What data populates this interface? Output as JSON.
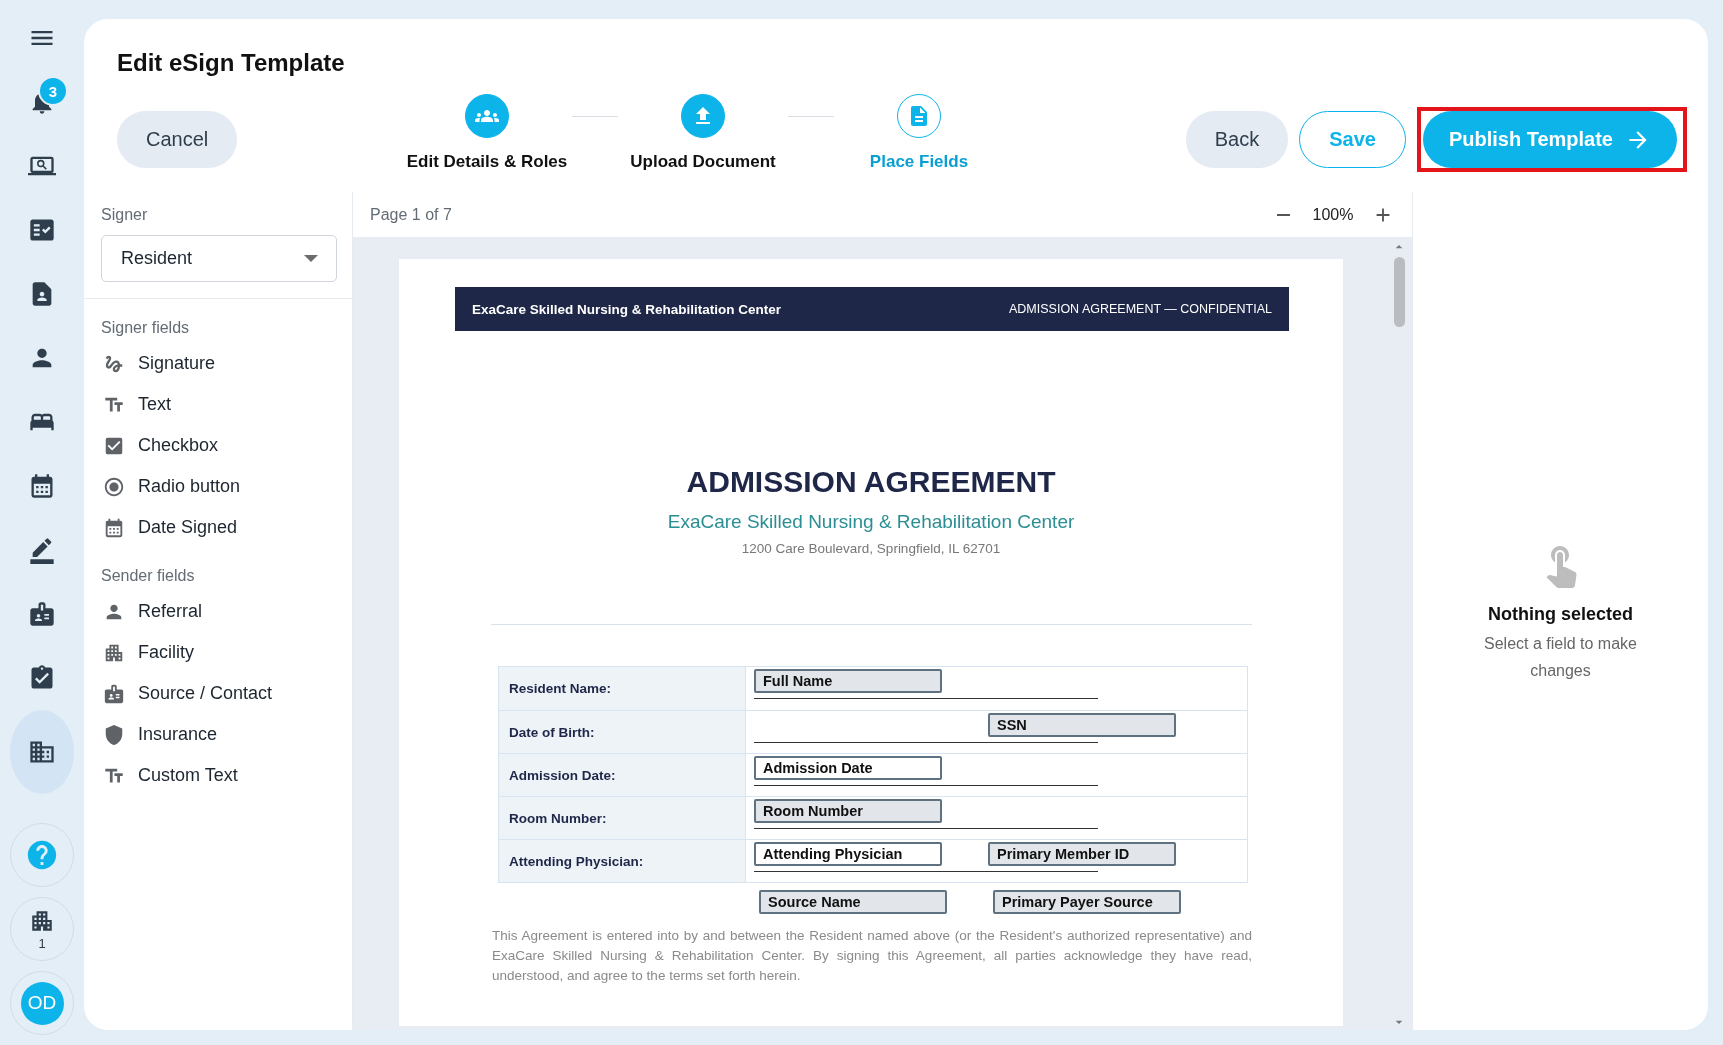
{
  "rail": {
    "items": [
      {
        "selected": false,
        "badge": "3"
      },
      {
        "selected": false
      },
      {
        "selected": false
      },
      {
        "selected": false
      },
      {
        "selected": false
      },
      {
        "selected": false
      },
      {
        "selected": false
      },
      {
        "selected": false
      },
      {
        "selected": false
      },
      {
        "selected": false
      },
      {
        "selected": true
      }
    ],
    "facility_count": "1",
    "avatar_initials": "OD"
  },
  "title": "Edit eSign Template",
  "cancel": "Cancel",
  "stepper": [
    {
      "label": "Edit Details & Roles",
      "selected": false
    },
    {
      "label": "Upload Document",
      "selected": false
    },
    {
      "label": "Place Fields",
      "selected": true
    }
  ],
  "actions": {
    "back": "Back",
    "save": "Save",
    "publish": {
      "label": "Publish Template",
      "highlighted": true
    }
  },
  "signer": {
    "label": "Signer",
    "value": "Resident"
  },
  "field_groups": [
    {
      "title": "Signer fields",
      "items": [
        "Signature",
        "Text",
        "Checkbox",
        "Radio button",
        "Date Signed"
      ]
    },
    {
      "title": "Sender fields",
      "items": [
        "Referral",
        "Facility",
        "Source / Contact",
        "Insurance",
        "Custom Text"
      ]
    }
  ],
  "viewer": {
    "page_indicator": "Page 1 of 7",
    "zoom": "100%"
  },
  "document": {
    "header_left": "ExaCare Skilled Nursing & Rehabilitation Center",
    "header_right": "ADMISSION AGREEMENT — CONFIDENTIAL",
    "title": "ADMISSION AGREEMENT",
    "subtitle": "ExaCare Skilled Nursing & Rehabilitation Center",
    "address": "1200 Care Boulevard, Springfield, IL 62701",
    "rows": [
      {
        "label": "Resident Name:",
        "left_field": {
          "label": "Full Name",
          "shaded": true
        }
      },
      {
        "label": "Date of Birth:",
        "right_field": {
          "label": "SSN",
          "shaded": true
        }
      },
      {
        "label": "Admission Date:",
        "left_field": {
          "label": "Admission Date",
          "shaded": false
        }
      },
      {
        "label": "Room Number:",
        "left_field": {
          "label": "Room Number",
          "shaded": true
        }
      },
      {
        "label": "Attending Physician:",
        "left_field": {
          "label": "Attending Physician",
          "shaded": false
        },
        "right_field": {
          "label": "Primary Member ID",
          "shaded": true
        }
      }
    ],
    "extra_fields": {
      "left_field": {
        "label": "Source Name",
        "shaded": true
      },
      "right_field": {
        "label": "Primary Payer Source",
        "shaded": true
      }
    },
    "paragraph": "This Agreement is entered into by and between the Resident named above (or the Resident's authorized representative) and ExaCare Skilled Nursing & Rehabilitation Center. By signing this Agreement, all parties acknowledge they have read, understood, and agree to the terms set forth herein."
  },
  "inspector": {
    "title": "Nothing selected",
    "hint": "Select a field to make changes"
  }
}
